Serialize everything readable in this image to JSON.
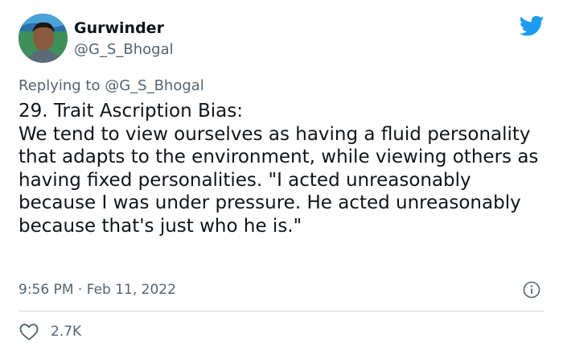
{
  "author": {
    "display_name": "Gurwinder",
    "handle": "@G_S_Bhogal",
    "avatar_icon": "profile-photo"
  },
  "reply": {
    "prefix": "Replying to ",
    "mention": "@G_S_Bhogal"
  },
  "tweet": {
    "text": "29. Trait Ascription Bias:\nWe tend to view ourselves as having a fluid personality that adapts to the environment, while viewing others as having fixed personalities. \"I acted unreasonably because I was under pressure. He acted unreasonably because that's just who he is.\""
  },
  "meta": {
    "time": "9:56 PM",
    "separator": "·",
    "date": "Feb 11, 2022"
  },
  "stats": {
    "likes": "2.7K"
  },
  "icons": {
    "brand": "twitter-bird-icon",
    "info": "info-icon",
    "like": "heart-icon"
  },
  "colors": {
    "brand": "#1d9bf0",
    "text": "#0f1419",
    "secondary": "#536471",
    "divider": "#cfd9de"
  }
}
